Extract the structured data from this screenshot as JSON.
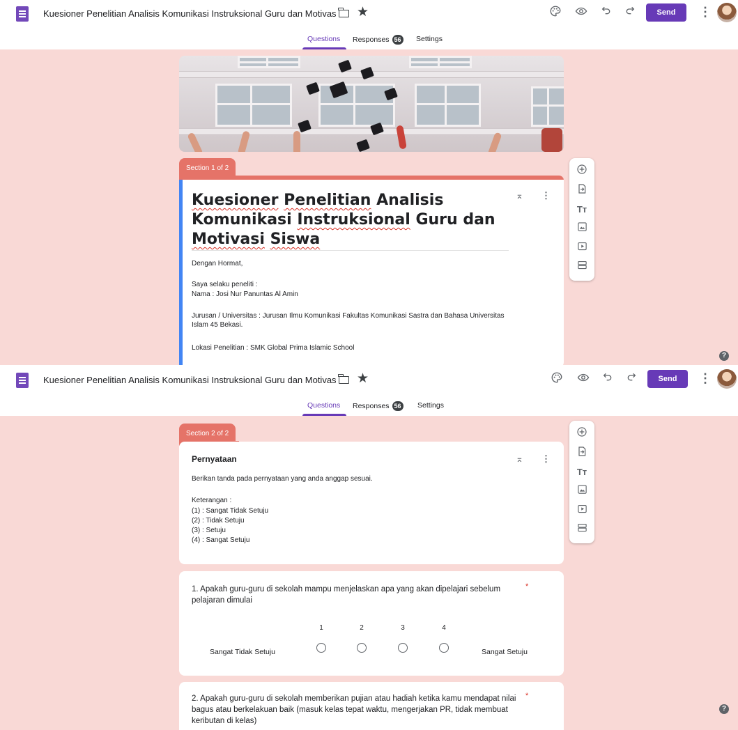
{
  "header": {
    "doc_title": "Kuesioner Penelitian Analisis Komunikasi Instruksional Guru dan Motivasi Siswa",
    "send_label": "Send",
    "icons": [
      "palette-icon",
      "eye-icon",
      "undo-icon",
      "redo-icon",
      "more-vert-icon"
    ]
  },
  "tabs": {
    "questions": "Questions",
    "responses": "Responses",
    "responses_count": "56",
    "settings": "Settings"
  },
  "colors": {
    "accent": "#673ab7",
    "section": "#e57368",
    "canvas": "#f9d9d6",
    "left_border": "#4285f4"
  },
  "section1": {
    "tab": "Section 1 of 2",
    "title_words": [
      "Kuesioner",
      "Penelitian",
      "Analisis",
      "Komunikasi",
      "Instruksional",
      "Guru dan",
      "Motivasi",
      "Siswa"
    ],
    "desc": {
      "greeting": "Dengan Hormat,",
      "intro": "Saya selaku peneliti :",
      "name": "Nama : Josi Nur Panuntas Al Amin",
      "major": "Jurusan / Universitas : Jurusan Ilmu Komunikasi Fakultas Komunikasi Sastra dan Bahasa Universitas Islam 45 Bekasi.",
      "location": "Lokasi Penelitian : SMK Global Prima Islamic School"
    }
  },
  "section2": {
    "tab": "Section 2 of 2",
    "title": "Pernyataan",
    "instruction": "Berikan tanda pada pernyataan yang anda anggap sesuai.",
    "legend_title": "Keterangan :",
    "legend": [
      "(1) : Sangat Tidak Setuju",
      "(2) : Tidak Setuju",
      "(3) : Setuju",
      "(4) : Sangat Setuju"
    ]
  },
  "questions": [
    {
      "text": "1. Apakah guru-guru di sekolah mampu menjelaskan apa yang akan dipelajari sebelum pelajaran dimulai",
      "required_mark": "*",
      "scale": [
        "1",
        "2",
        "3",
        "4"
      ],
      "low_label": "Sangat Tidak Setuju",
      "high_label": "Sangat Setuju"
    },
    {
      "text": "2.  Apakah guru-guru di sekolah memberikan pujian atau hadiah ketika kamu mendapat nilai bagus atau berkelakuan baik (masuk kelas tepat waktu, mengerjakan PR, tidak membuat keributan di kelas)",
      "required_mark": "*"
    }
  ],
  "toolbar": {
    "items": [
      "add-question-icon",
      "import-questions-icon",
      "add-title-icon",
      "add-image-icon",
      "add-video-icon",
      "add-section-icon"
    ],
    "title_glyph": "Tт"
  },
  "help_glyph": "?",
  "star_glyph": "★"
}
